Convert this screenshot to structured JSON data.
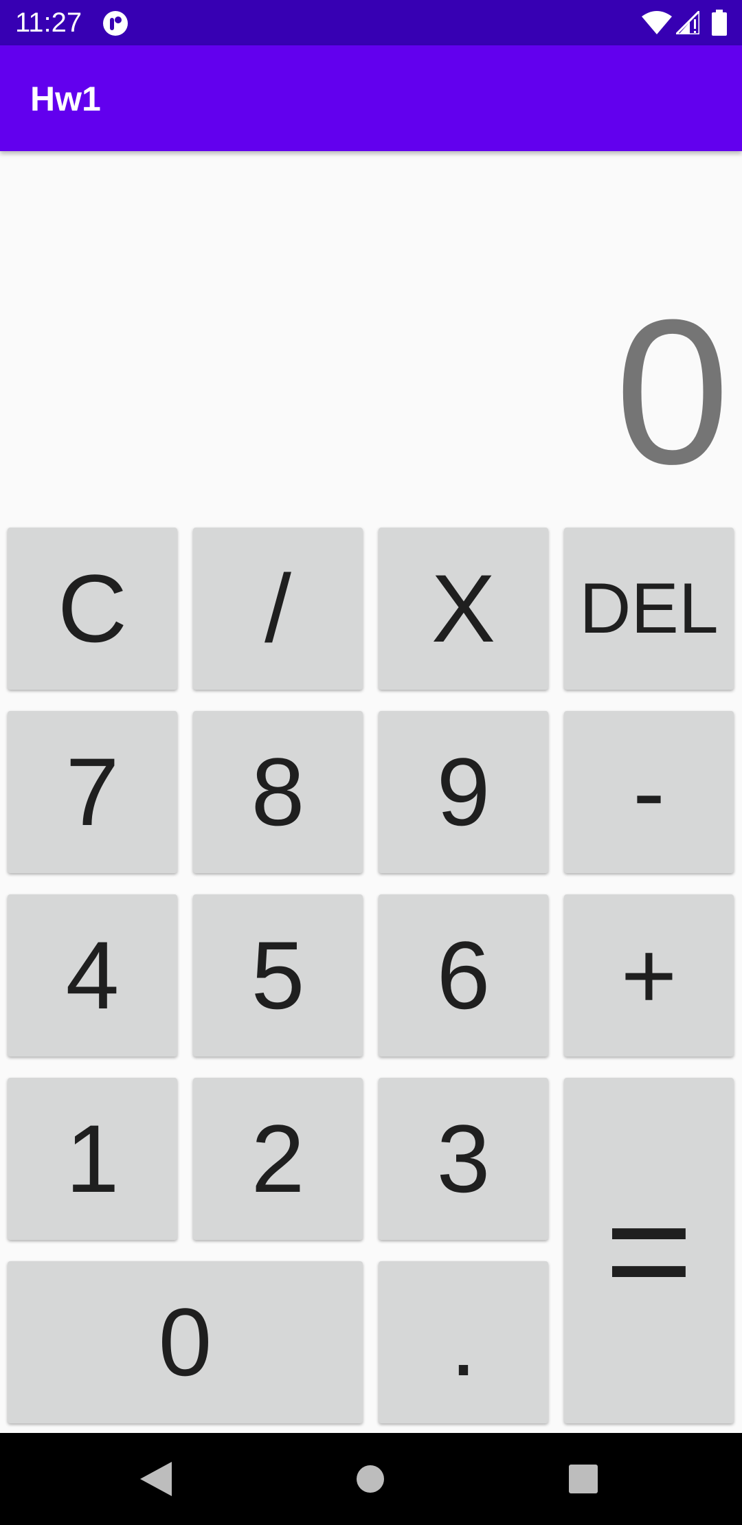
{
  "status_bar": {
    "time": "11:27",
    "icons": [
      "notification-app-icon",
      "wifi-icon",
      "signal-icon",
      "battery-icon"
    ]
  },
  "app_bar": {
    "title": "Hw1",
    "color": "#6200ee",
    "status_color": "#3700b3"
  },
  "display": {
    "value": "0"
  },
  "keypad": {
    "clear": "C",
    "divide": "/",
    "multiply": "X",
    "delete": "DEL",
    "seven": "7",
    "eight": "8",
    "nine": "9",
    "minus": "-",
    "four": "4",
    "five": "5",
    "six": "6",
    "plus": "+",
    "one": "1",
    "two": "2",
    "three": "3",
    "equals": "=",
    "zero": "0",
    "decimal": "."
  },
  "nav_bar": {
    "icons": [
      "back-icon",
      "home-icon",
      "recents-icon"
    ]
  }
}
